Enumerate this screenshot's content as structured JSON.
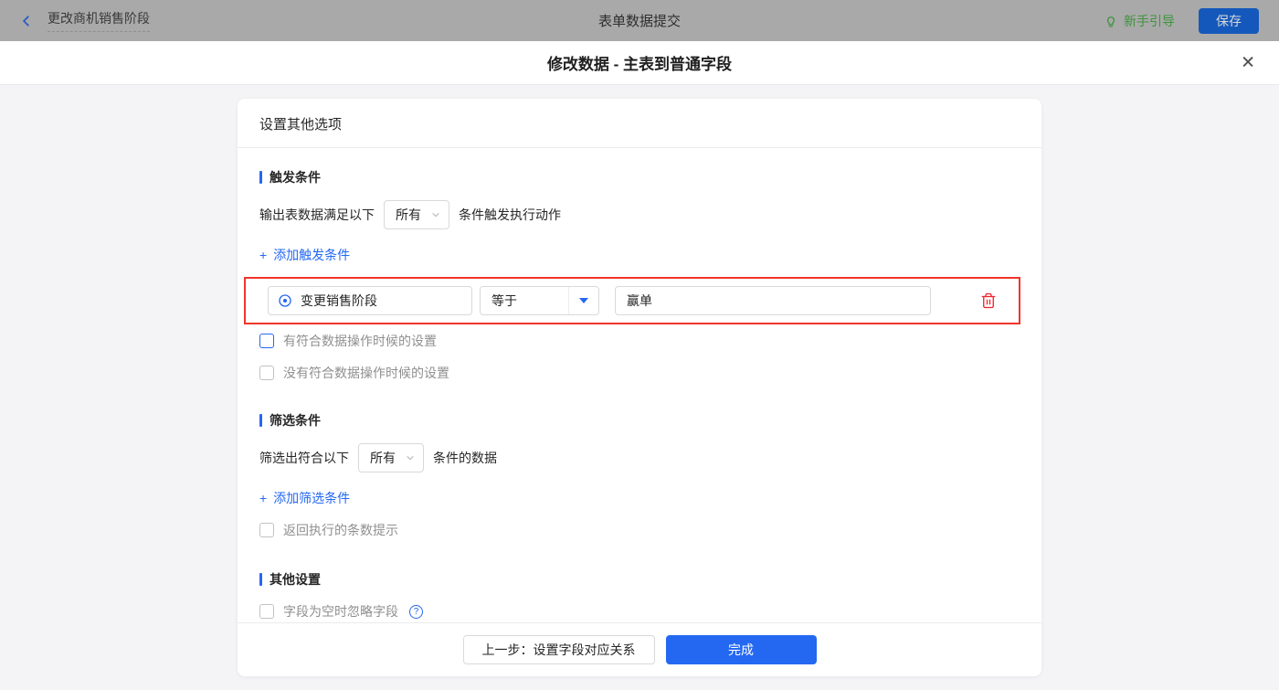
{
  "topbar": {
    "back_title": "更改商机销售阶段",
    "center_title": "表单数据提交",
    "guide_label": "新手引导",
    "save_label": "保存"
  },
  "modal": {
    "title": "修改数据 - 主表到普通字段"
  },
  "icons": {
    "close": "✕",
    "plus": "+",
    "help": "?"
  },
  "card": {
    "header": "设置其他选项",
    "trigger_section": {
      "title": "触发条件",
      "prefix": "输出表数据满足以下",
      "select_value": "所有",
      "suffix": "条件触发执行动作",
      "add_label": "添加触发条件",
      "condition": {
        "field": "变更销售阶段",
        "operator": "等于",
        "value": "赢单"
      },
      "checkboxes": [
        {
          "label": "有符合数据操作时候的设置",
          "checked": false
        },
        {
          "label": "没有符合数据操作时候的设置",
          "checked": false
        }
      ]
    },
    "filter_section": {
      "title": "筛选条件",
      "prefix": "筛选出符合以下",
      "select_value": "所有",
      "suffix": "条件的数据",
      "add_label": "添加筛选条件",
      "checkbox_label": "返回执行的条数提示"
    },
    "other_section": {
      "title": "其他设置",
      "checkbox_label": "字段为空时忽略字段"
    },
    "footer": {
      "prev_label": "上一步：设置字段对应关系",
      "done_label": "完成"
    }
  },
  "colors": {
    "accent_blue": "#2468f2",
    "highlight_red": "#f0342b",
    "guide_green": "#3f9440",
    "topbar_dimmed": "#a9a9a9"
  }
}
